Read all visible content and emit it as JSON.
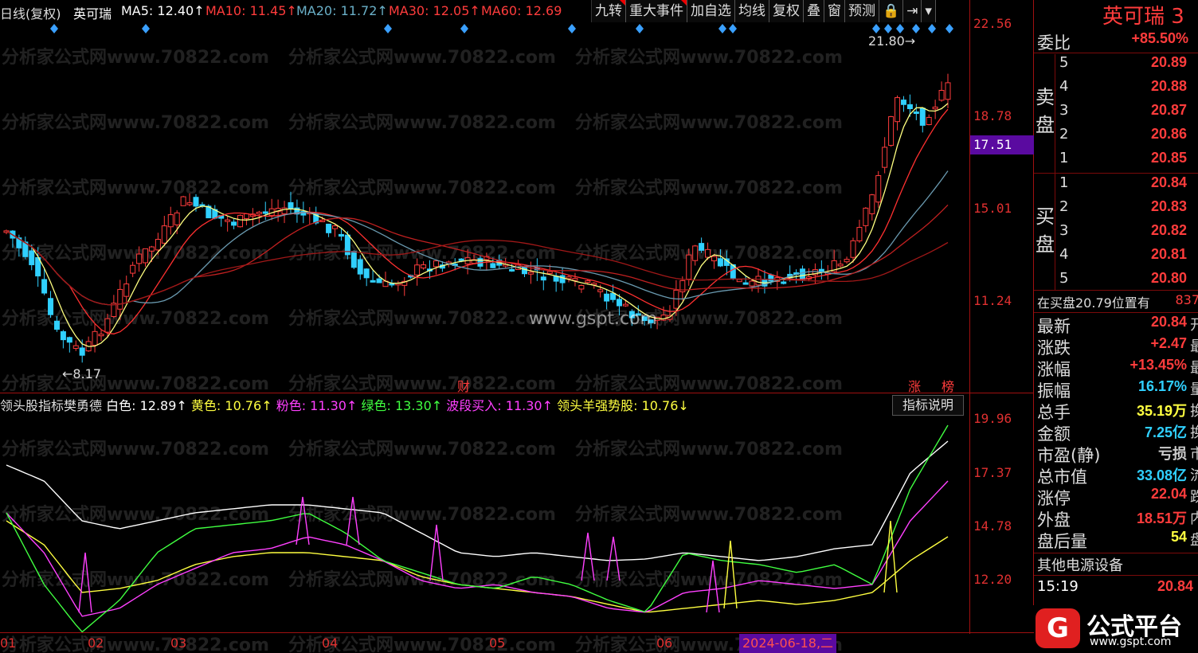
{
  "topbar": {
    "period": "日线(复权)",
    "stock": "英可瑞",
    "ma5": "MA5: 12.40↑",
    "ma10": "MA10: 11.45↑",
    "ma20": "MA20: 11.72↑",
    "ma30": "MA30: 12.05↑",
    "ma60": "MA60: 12.69"
  },
  "toolbar": [
    "九转",
    "重大事件",
    "加自选",
    "均线",
    "复权",
    "叠",
    "窗",
    "预测",
    "🔒",
    "⇥",
    "▾"
  ],
  "yaxis_main": [
    "22.56",
    "18.78",
    "15.01",
    "11.24"
  ],
  "yaxis_ind": [
    "19.96",
    "17.37",
    "14.78",
    "12.20"
  ],
  "price_highlight": "17.51",
  "annotations": {
    "high": "21.80→",
    "low": "←8.17",
    "cai": "财",
    "zhang": "涨",
    "bang": "榜",
    "site": "www.gspt.com"
  },
  "indicator": {
    "name": "领头股指标樊勇德",
    "white": "白色: 12.89↑",
    "yellow": "黄色: 10.76↑",
    "pink": "粉色: 11.30↑",
    "green": "绿色: 13.30↑",
    "wave": "波段买入: 11.30↑",
    "leader": "领头羊强势股: 10.76↓",
    "desc_button": "指标说明"
  },
  "xaxis": [
    "01",
    "02",
    "03",
    "04",
    "05",
    "06"
  ],
  "date_highlight": "2024-06-18,二",
  "watermark": "分析家公式网www.70822.com",
  "panel": {
    "title": "英可瑞 3",
    "webi_label": "委比",
    "webi_value": "+85.50%",
    "sell_label_1": "卖",
    "sell_label_2": "盘",
    "buy_label_1": "买",
    "buy_label_2": "盘",
    "sell": [
      {
        "n": "5",
        "p": "20.89"
      },
      {
        "n": "4",
        "p": "20.88"
      },
      {
        "n": "3",
        "p": "20.87"
      },
      {
        "n": "2",
        "p": "20.86"
      },
      {
        "n": "1",
        "p": "20.85"
      }
    ],
    "buy": [
      {
        "n": "1",
        "p": "20.84"
      },
      {
        "n": "2",
        "p": "20.83"
      },
      {
        "n": "3",
        "p": "20.82"
      },
      {
        "n": "4",
        "p": "20.81"
      },
      {
        "n": "5",
        "p": "20.80"
      }
    ],
    "notice": "在买盘20.79位置有",
    "notice_tail": "837",
    "stats": [
      {
        "k": "最新",
        "v": "20.84",
        "c": "red",
        "x": "开"
      },
      {
        "k": "涨跌",
        "v": "+2.47",
        "c": "red",
        "x": "最"
      },
      {
        "k": "涨幅",
        "v": "+13.45%",
        "c": "red",
        "x": "最"
      },
      {
        "k": "振幅",
        "v": "16.17%",
        "c": "cyan",
        "x": "量"
      },
      {
        "k": "总手",
        "v": "35.19万",
        "c": "yellow",
        "x": "换"
      },
      {
        "k": "金额",
        "v": "7.25亿",
        "c": "cyan",
        "x": "换"
      },
      {
        "k": "市盈(静)",
        "v": "亏损",
        "c": "grey",
        "x": "市"
      },
      {
        "k": "总市值",
        "v": "33.08亿",
        "c": "cyan",
        "x": "流"
      },
      {
        "k": "涨停",
        "v": "22.04",
        "c": "red",
        "x": "跌"
      },
      {
        "k": "外盘",
        "v": "18.51万",
        "c": "red",
        "x": "内"
      },
      {
        "k": "盘后量",
        "v": "54",
        "c": "yellow",
        "x": "盘"
      }
    ],
    "sector": "其他电源设备",
    "time": "15:19",
    "last_price": "20.84"
  },
  "logo": {
    "name": "公式平台",
    "url": "www.gspt.com",
    "mark": "G"
  },
  "colors": {
    "up": "#ff3c3c",
    "down": "#30d0ff",
    "axis": "#a01010",
    "highlight": "#5a0aa0"
  }
}
